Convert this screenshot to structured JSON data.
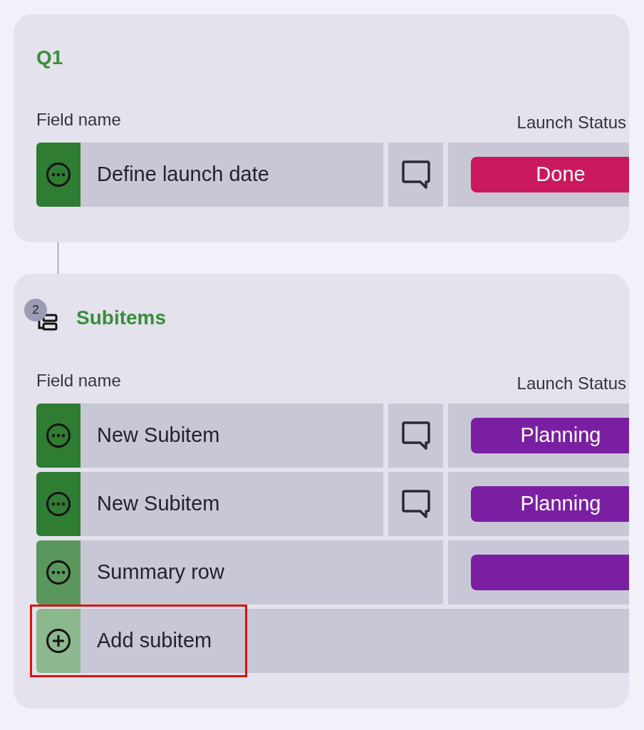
{
  "groups": [
    {
      "title": "Q1",
      "columns": [
        "Field name",
        "Launch Status"
      ],
      "rows": [
        {
          "kind": "item",
          "name": "Define launch date",
          "color": "#2e7d32",
          "status": {
            "label": "Done",
            "color": "#c9185b"
          }
        }
      ]
    },
    {
      "title": "Subitems",
      "badge": "2",
      "columns": [
        "Field name",
        "Launch Status"
      ],
      "rows": [
        {
          "kind": "item",
          "name": "New Subitem",
          "color": "#2e7d32",
          "status": {
            "label": "Planning",
            "color": "#7b1fa2"
          }
        },
        {
          "kind": "item",
          "name": "New Subitem",
          "color": "#2e7d32",
          "status": {
            "label": "Planning",
            "color": "#7b1fa2"
          }
        },
        {
          "kind": "summary",
          "name": "Summary row",
          "color": "#5a975d",
          "status": {
            "color": "#7b1fa2"
          }
        },
        {
          "kind": "add",
          "name": "Add subitem",
          "color": "#8bb88d",
          "highlighted": true
        }
      ]
    }
  ]
}
